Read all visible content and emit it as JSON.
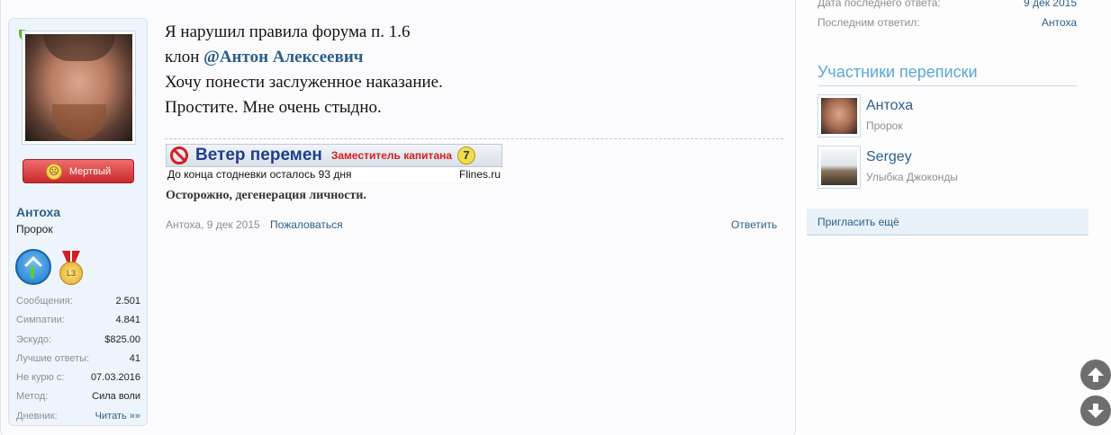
{
  "user": {
    "name": "Антоха",
    "title": "Пророк",
    "status_badge": "Мертвый",
    "stats": [
      {
        "label": "Сообщения:",
        "value": "2.501"
      },
      {
        "label": "Симпатии:",
        "value": "4.841"
      },
      {
        "label": "Эскудо:",
        "value": "$825.00"
      },
      {
        "label": "Лучшие ответы:",
        "value": "41"
      },
      {
        "label": "Не курю с:",
        "value": "07.03.2016"
      },
      {
        "label": "Метод:",
        "value": "Сила воли"
      },
      {
        "label": "Дневник:",
        "value": "Читать »»"
      }
    ],
    "trophy_level": "L3"
  },
  "message": {
    "line1": "Я нарушил правила форума п. 1.6",
    "line2_prefix": "клон ",
    "mention": "@Антон Алексеевич",
    "line3": "Хочу понести заслуженное наказание.",
    "line4": "Простите. Мне очень стыдно."
  },
  "signature": {
    "banner_title": "Ветер перемен",
    "banner_role": "Заместитель капитана",
    "banner_number": "7",
    "countdown": "До конца стодневки осталось 93 дня",
    "site": "Flines.ru",
    "quote": "Осторожно, дегенерация личности."
  },
  "post_meta": {
    "author_date": "Антоха, 9 дек 2015",
    "report": "Пожаловаться",
    "reply": "Ответить"
  },
  "sidebar": {
    "info": [
      {
        "label": "Дата последнего ответа:",
        "value": "9 дек 2015"
      },
      {
        "label": "Последним ответил:",
        "value": "Антоха"
      }
    ],
    "participants_title": "Участники переписки",
    "participants": [
      {
        "name": "Антоха",
        "title": "Пророк"
      },
      {
        "name": "Sergey",
        "title": "Улыбка Джоконды"
      }
    ],
    "invite": "Пригласить ещё"
  }
}
